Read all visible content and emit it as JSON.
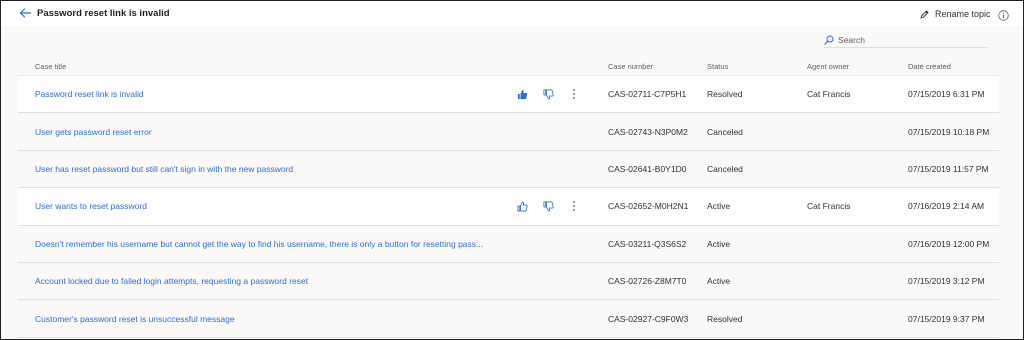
{
  "header": {
    "title": "Password reset link is invalid",
    "rename_label": "Rename topic",
    "back_icon": "back-arrow-icon",
    "info_icon": "info-icon"
  },
  "search": {
    "placeholder": "Search"
  },
  "columns": {
    "case_title": "Case title",
    "case_number": "Case number",
    "status": "Status",
    "agent_owner": "Agent owner",
    "date_created": "Date created"
  },
  "rows": [
    {
      "title": "Password reset link is invalid",
      "case_number": "CAS-02711-C7P5H1",
      "status": "Resolved",
      "owner": "Cat Francis",
      "date": "07/15/2019 6:31 PM",
      "show_actions": true,
      "thumbs_up_active": true
    },
    {
      "title": "User gets password reset error",
      "case_number": "CAS-02743-N3P0M2",
      "status": "Canceled",
      "owner": "",
      "date": "07/15/2019 10:18 PM",
      "show_actions": false,
      "thumbs_up_active": false
    },
    {
      "title": "User has reset password but still can't sign in with the new password",
      "case_number": "CAS-02641-B0Y1D0",
      "status": "Canceled",
      "owner": "",
      "date": "07/15/2019 11:57 PM",
      "show_actions": false,
      "thumbs_up_active": false
    },
    {
      "title": "User wants to reset password",
      "case_number": "CAS-02652-M0H2N1",
      "status": "Active",
      "owner": "Cat Francis",
      "date": "07/16/2019 2:14 AM",
      "show_actions": true,
      "thumbs_up_active": false
    },
    {
      "title": "Doesn't remember his username but cannot get the way to find his username, there is only a button for resetting pass...",
      "case_number": "CAS-03211-Q3S6S2",
      "status": "Active",
      "owner": "",
      "date": "07/16/2019 12:00 PM",
      "show_actions": false,
      "thumbs_up_active": false
    },
    {
      "title": "Account locked due to failed login attempts, requesting a password reset",
      "case_number": "CAS-02726-Z8M7T0",
      "status": "Active",
      "owner": "",
      "date": "07/15/2019 3:12 PM",
      "show_actions": false,
      "thumbs_up_active": false
    },
    {
      "title": "Customer's password reset is unsuccessful message",
      "case_number": "CAS-02927-C9F0W3",
      "status": "Resolved",
      "owner": "",
      "date": "07/15/2019 9:37 PM",
      "show_actions": false,
      "thumbs_up_active": false
    }
  ],
  "colors": {
    "link": "#2f6ecb",
    "accent": "#2f6ecb",
    "text": "#323130",
    "muted": "#605e5c"
  }
}
